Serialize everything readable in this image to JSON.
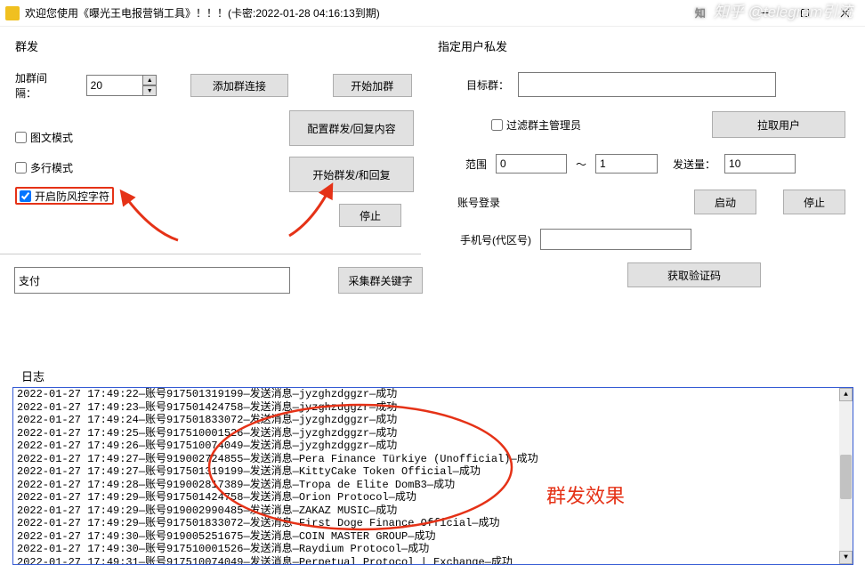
{
  "window": {
    "title": "欢迎您使用《曝光王电报营销工具》！！！(卡密:2022-01-28 04:16:13到期)"
  },
  "left": {
    "group_title": "群发",
    "interval_label": "加群间隔：",
    "interval_value": "20",
    "btn_add_link": "添加群连接",
    "btn_start_join": "开始加群",
    "chk_image_mode": "图文模式",
    "chk_multiline": "多行模式",
    "chk_anti_control": "开启防风控字符",
    "btn_config": "配置群发/回复内容",
    "btn_start_send": "开始群发/和回复",
    "btn_stop": "停止",
    "keyword_value": "支付",
    "btn_collect_keyword": "采集群关键字"
  },
  "right": {
    "group_title": "指定用户私发",
    "target_group_label": "目标群：",
    "chk_filter_admin": "过滤群主管理员",
    "btn_pull_users": "拉取用户",
    "range_label": "范围",
    "range_from": "0",
    "range_sep": "～",
    "range_to": "1",
    "send_count_label": "发送量：",
    "send_count_value": "10",
    "login_label": "账号登录",
    "btn_start": "启动",
    "btn_stop": "停止",
    "phone_label": "手机号(代区号)",
    "btn_get_code": "获取验证码"
  },
  "log_title": "日志",
  "logs": [
    "2022-01-27 17:49:22—账号917501319199—发送消息—jyzghzdggzr—成功",
    "2022-01-27 17:49:23—账号917501424758—发送消息—jyzghzdggzr—成功",
    "2022-01-27 17:49:24—账号917501833072—发送消息—jyzghzdggzr—成功",
    "2022-01-27 17:49:25—账号917510001526—发送消息—jyzghzdggzr—成功",
    "2022-01-27 17:49:26—账号917510074049—发送消息—jyzghzdggzr—成功",
    "2022-01-27 17:49:27—账号919002724855—发送消息—Pera Finance Türkiye (Unofficial)—成功",
    "2022-01-27 17:49:27—账号917501319199—发送消息—KittyCake Token Official—成功",
    "2022-01-27 17:49:28—账号919002817389—发送消息—Tropa de Elite DomB3—成功",
    "2022-01-27 17:49:29—账号917501424758—发送消息—Orion Protocol—成功",
    "2022-01-27 17:49:29—账号919002990485—发送消息—ZAKAZ MUSIC—成功",
    "2022-01-27 17:49:29—账号917501833072—发送消息—First Doge Finance Official—成功",
    "2022-01-27 17:49:30—账号919005251675—发送消息—COIN MASTER GROUP—成功",
    "2022-01-27 17:49:30—账号917510001526—发送消息—Raydium Protocol—成功",
    "2022-01-27 17:49:31—账号917510074049—发送消息—Perpetual Protocol | Exchange—成功"
  ],
  "annotation_label": "群发效果",
  "watermark": "知乎 @telegram引流"
}
